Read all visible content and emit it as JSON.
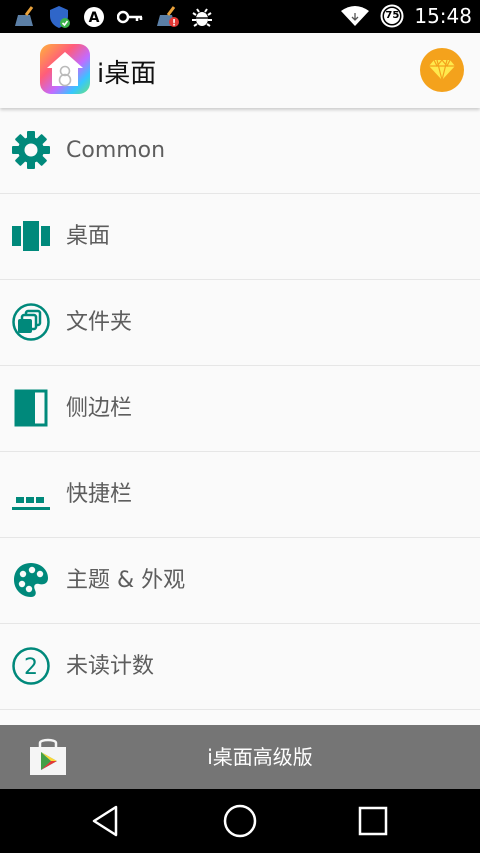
{
  "status_bar": {
    "time": "15:48",
    "battery": "75",
    "icons": [
      "cleaner-icon",
      "shield-icon",
      "a-icon",
      "key-icon",
      "cleaner-alert-icon",
      "bug-icon",
      "wifi-icon",
      "battery-icon"
    ]
  },
  "app_bar": {
    "title": "i桌面",
    "logo_icon": "house-8-icon",
    "premium_icon": "diamond-icon"
  },
  "menu": {
    "items": [
      {
        "label": "Common",
        "icon": "gear-icon"
      },
      {
        "label": "桌面",
        "icon": "desktop-panels-icon"
      },
      {
        "label": "文件夹",
        "icon": "folder-stack-icon"
      },
      {
        "label": "侧边栏",
        "icon": "sidebar-icon"
      },
      {
        "label": "快捷栏",
        "icon": "dock-icon"
      },
      {
        "label": "主题 & 外观",
        "icon": "palette-icon"
      },
      {
        "label": "未读计数",
        "icon": "badge-2-icon"
      }
    ],
    "badge_number": "2"
  },
  "promo": {
    "label": "i桌面高级版",
    "icon": "play-store-icon"
  },
  "navigation": {
    "buttons": [
      "back",
      "home",
      "recents"
    ]
  },
  "colors": {
    "accent": "#00897b",
    "text": "#5d5d5d",
    "promo_bg": "#757575",
    "premium": "#f4a21c"
  }
}
